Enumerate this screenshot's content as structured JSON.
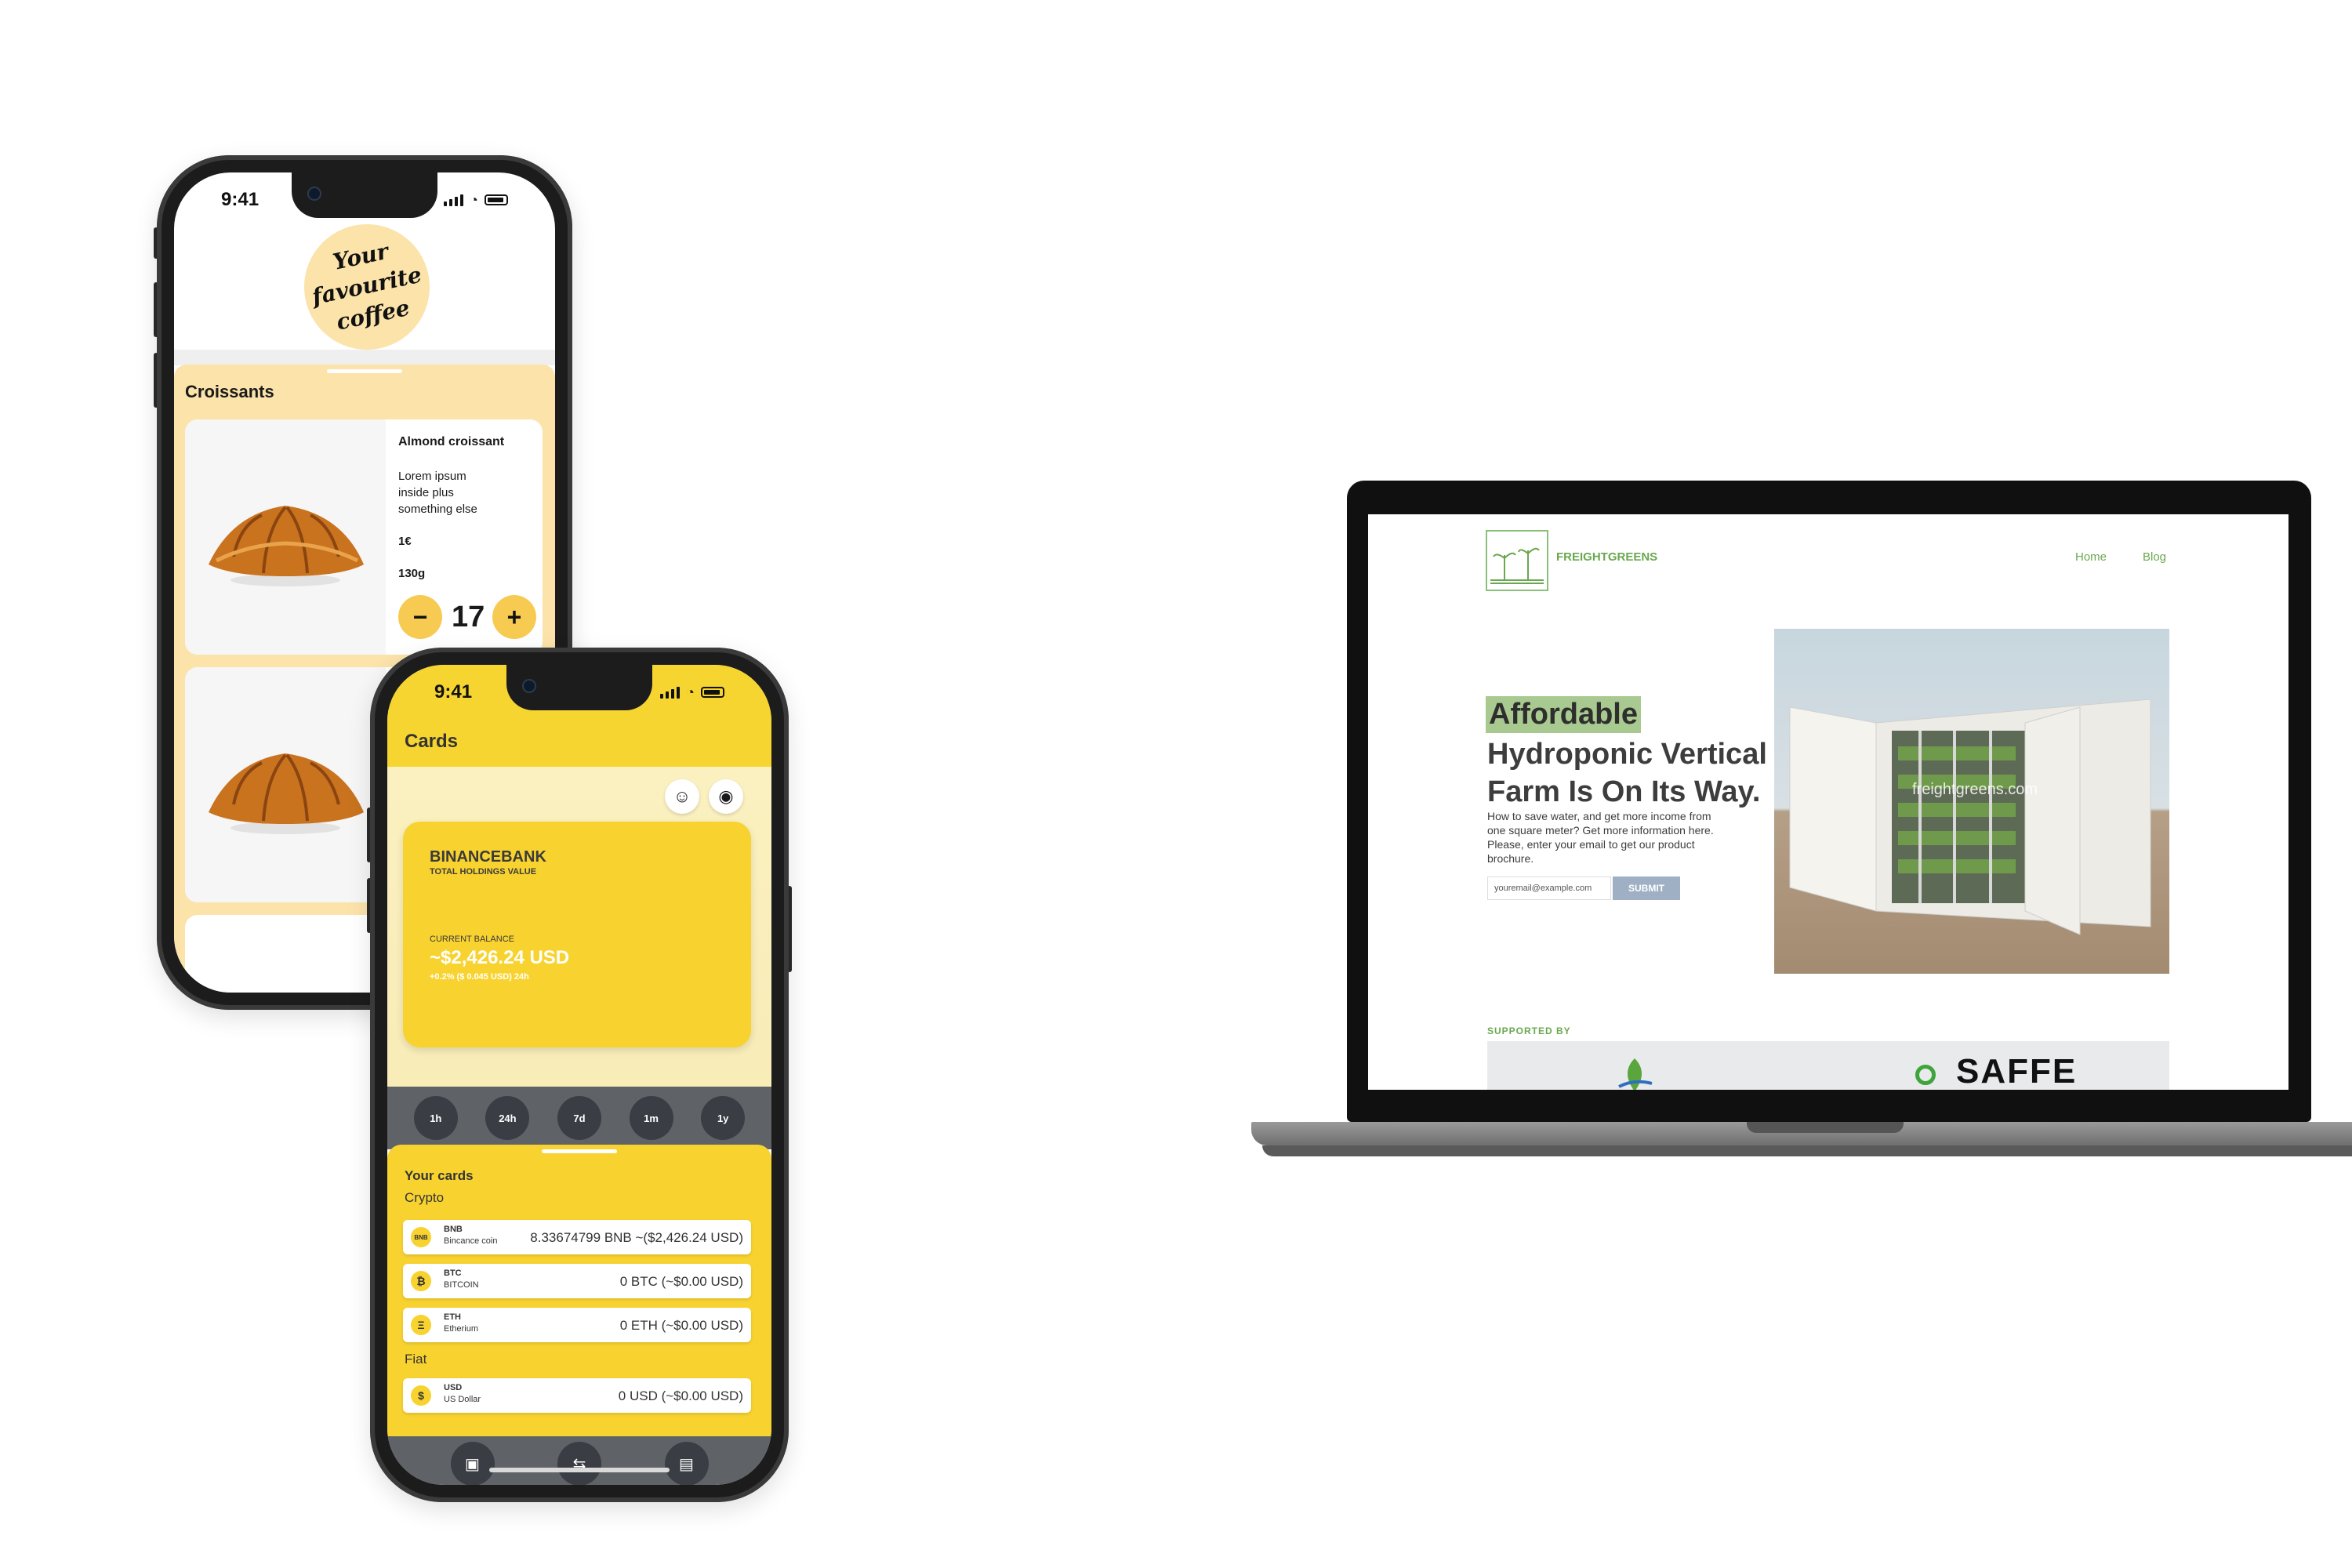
{
  "coffee_app": {
    "status_time": "9:41",
    "logo_lines": [
      "Your",
      "favourite",
      "coffee"
    ],
    "section_title": "Croissants",
    "product": {
      "name": "Almond croissant",
      "description": "Lorem ipsum inside plus something else",
      "price": "1€",
      "weight": "130g",
      "quantity": "17",
      "minus": "−",
      "plus": "+"
    }
  },
  "crypto_app": {
    "status_time": "9:41",
    "title": "Cards",
    "card": {
      "bank_name": "BINANCEBANK",
      "subtitle": "TOTAL HOLDINGS VALUE",
      "balance_label": "CURRENT BALANCE",
      "balance": "~$2,426.24 USD",
      "change": "+0.2% ($ 0.045 USD) 24h"
    },
    "ranges": [
      "1h",
      "24h",
      "7d",
      "1m",
      "1y"
    ],
    "your_cards": "Your cards",
    "crypto_group": "Crypto",
    "fiat_group": "Fiat",
    "coins": [
      {
        "icon": "BNB",
        "symbol": "BNB",
        "name": "Bincance coin",
        "value": "8.33674799 BNB ~($2,426.24 USD)"
      },
      {
        "icon": "₿",
        "symbol": "BTC",
        "name": "BITCOIN",
        "value": "0 BTC (~$0.00 USD)"
      },
      {
        "icon": "Ξ",
        "symbol": "ETH",
        "name": "Etherium",
        "value": "0 ETH (~$0.00 USD)"
      }
    ],
    "fiat": [
      {
        "icon": "$",
        "symbol": "USD",
        "name": "US Dollar",
        "value": "0 USD (~$0.00 USD)"
      }
    ],
    "nav_icons": [
      "wallet-icon",
      "transfer-icon",
      "contacts-icon"
    ]
  },
  "website": {
    "brand": "FREIGHTGREENS",
    "nav": [
      "Home",
      "Blog"
    ],
    "highlight": "Affordable",
    "headline": "Hydroponic Vertical Farm Is On Its Way.",
    "description": "How to save water, and get more income from one square meter? Get more information here. Please, enter your email to get our product brochure.",
    "email_placeholder": "youremail@example.com",
    "submit_label": "SUBMIT",
    "image_watermark": "freightgreens.com",
    "supported_by": "SUPPORTED BY",
    "sponsor": "SAFFE"
  },
  "colors": {
    "coffee_accent": "#fbe3aa",
    "coffee_button": "#f7ca52",
    "crypto_yellow": "#f8d330",
    "crypto_dark": "#3a3e44",
    "site_green": "#6aa84f"
  }
}
